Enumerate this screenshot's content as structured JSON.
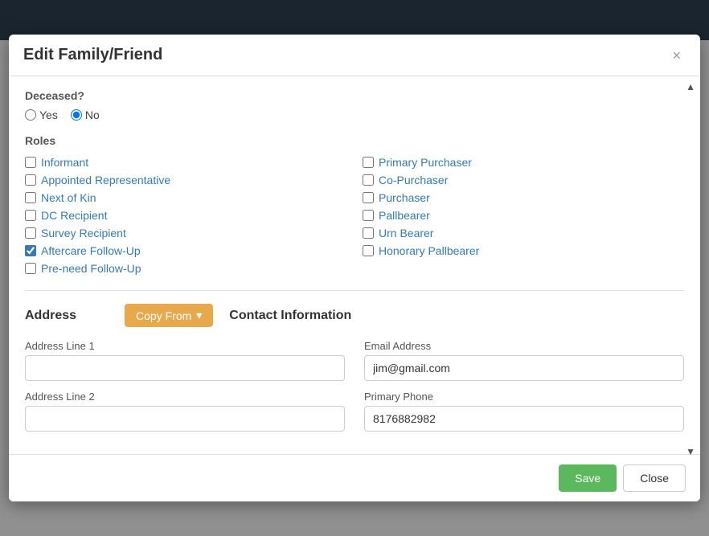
{
  "modal": {
    "title": "Edit Family/Friend",
    "close_label": "×"
  },
  "deceased": {
    "label": "Deceased?",
    "yes_label": "Yes",
    "no_label": "No",
    "selected": "no"
  },
  "roles": {
    "label": "Roles",
    "left_column": [
      {
        "id": "informant",
        "label": "Informant",
        "checked": false
      },
      {
        "id": "appointed-representative",
        "label": "Appointed Representative",
        "checked": false
      },
      {
        "id": "next-of-kin",
        "label": "Next of Kin",
        "checked": false
      },
      {
        "id": "dc-recipient",
        "label": "DC Recipient",
        "checked": false
      },
      {
        "id": "survey-recipient",
        "label": "Survey Recipient",
        "checked": false
      },
      {
        "id": "aftercare-follow-up",
        "label": "Aftercare Follow-Up",
        "checked": true
      },
      {
        "id": "pre-need-follow-up",
        "label": "Pre-need Follow-Up",
        "checked": false
      }
    ],
    "right_column": [
      {
        "id": "primary-purchaser",
        "label": "Primary Purchaser",
        "checked": false
      },
      {
        "id": "co-purchaser",
        "label": "Co-Purchaser",
        "checked": false
      },
      {
        "id": "purchaser",
        "label": "Purchaser",
        "checked": false
      },
      {
        "id": "pallbearer",
        "label": "Pallbearer",
        "checked": false
      },
      {
        "id": "urn-bearer",
        "label": "Urn Bearer",
        "checked": false
      },
      {
        "id": "honorary-pallbearer",
        "label": "Honorary Pallbearer",
        "checked": false
      }
    ]
  },
  "address": {
    "section_title": "Address",
    "copy_from_label": "Copy From",
    "dropdown_arrow": "▾",
    "address_line_1_label": "Address Line 1",
    "address_line_1_value": "",
    "address_line_1_placeholder": "",
    "address_line_2_label": "Address Line 2",
    "address_line_2_value": "",
    "address_line_2_placeholder": ""
  },
  "contact": {
    "section_title": "Contact Information",
    "email_label": "Email Address",
    "email_value": "jim@gmail.com",
    "phone_label": "Primary Phone",
    "phone_value": "8176882982"
  },
  "footer": {
    "save_label": "Save",
    "close_label": "Close"
  }
}
